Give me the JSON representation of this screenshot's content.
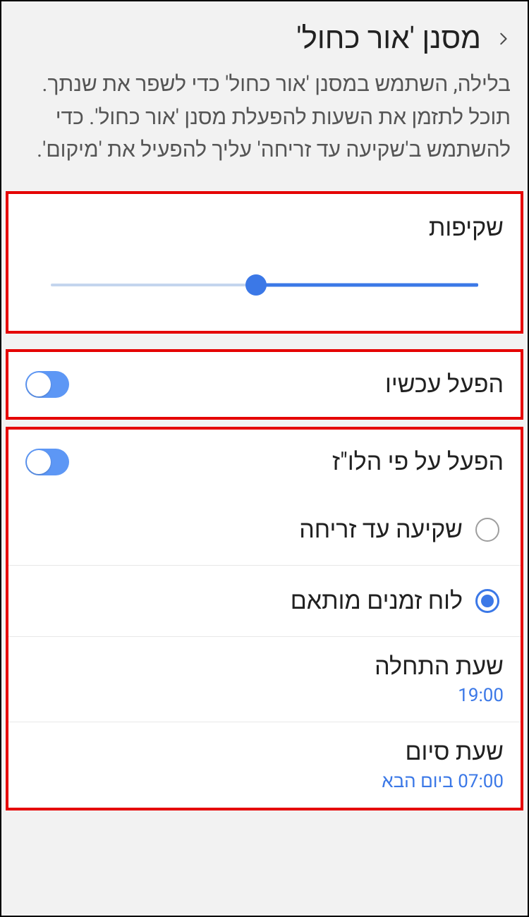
{
  "header": {
    "title": "מסנן 'אור כחול'"
  },
  "description": "בלילה, השתמש במסנן 'אור כחול' כדי לשפר את שנתך. תוכל לתזמן את השעות להפעלת מסנן 'אור כחול'. כדי להשתמש ב'שקיעה עד זריחה' עליך להפעיל את 'מיקום'.",
  "opacity": {
    "label": "שקיפות",
    "value_percent": 52
  },
  "toggles": {
    "apply_now": {
      "label": "הפעל עכשיו",
      "on": true
    },
    "apply_schedule": {
      "label": "הפעל על פי הלו\"ז",
      "on": true
    }
  },
  "schedule_options": {
    "sunset_sunrise": {
      "label": "שקיעה עד זריחה",
      "selected": false
    },
    "custom": {
      "label": "לוח זמנים מותאם",
      "selected": true
    }
  },
  "times": {
    "start": {
      "label": "שעת התחלה",
      "value": "19:00"
    },
    "end": {
      "label": "שעת סיום",
      "value": "07:00 ביום הבא"
    }
  },
  "colors": {
    "accent": "#3b78e7",
    "highlight_border": "#e50000"
  }
}
